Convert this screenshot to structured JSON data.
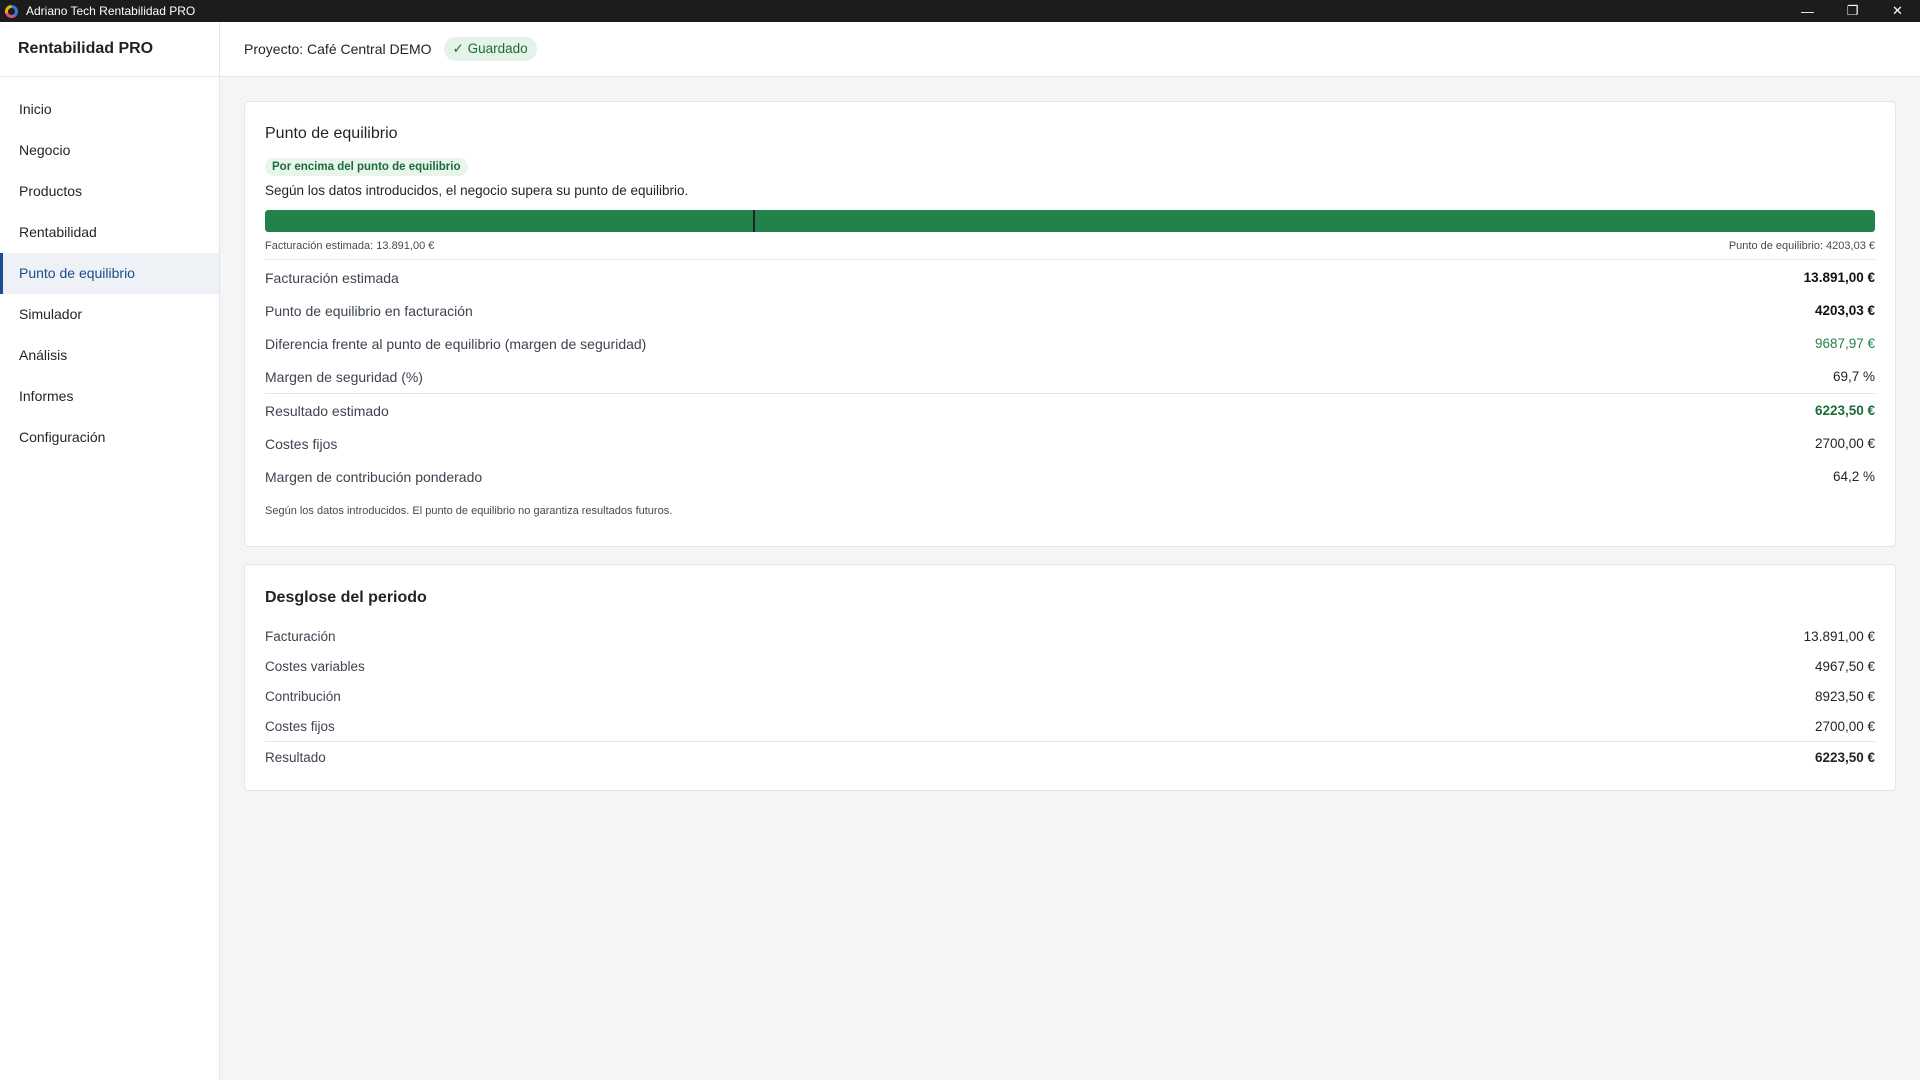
{
  "window": {
    "title": "Adriano Tech Rentabilidad PRO",
    "controls": {
      "minimize": "—",
      "maximize": "❐",
      "close": "✕"
    }
  },
  "sidebar": {
    "brand": "Rentabilidad PRO",
    "items": [
      {
        "label": "Inicio",
        "active": false
      },
      {
        "label": "Negocio",
        "active": false
      },
      {
        "label": "Productos",
        "active": false
      },
      {
        "label": "Rentabilidad",
        "active": false
      },
      {
        "label": "Punto de equilibrio",
        "active": true
      },
      {
        "label": "Simulador",
        "active": false
      },
      {
        "label": "Análisis",
        "active": false
      },
      {
        "label": "Informes",
        "active": false
      },
      {
        "label": "Configuración",
        "active": false
      }
    ]
  },
  "header": {
    "project": "Proyecto: Café Central DEMO",
    "saved": "✓ Guardado"
  },
  "breakeven": {
    "title": "Punto de equilibrio",
    "status": "Por encima del punto de equilibrio",
    "intro": "Según los datos introducidos, el negocio supera su punto de equilibrio.",
    "progress": {
      "fill_pct": 100,
      "breakeven_marker_pct": 30.3
    },
    "bar_left_label": "Facturación estimada: 13.891,00 €",
    "bar_right_label": "Punto de equilibrio: 4203,03 €",
    "metrics": [
      {
        "label": "Facturación estimada",
        "value": "13.891,00 €"
      },
      {
        "label": "Punto de equilibrio en facturación",
        "value": "4203,03 €"
      },
      {
        "label": "Diferencia frente al punto de equilibrio (margen de seguridad)",
        "value": "9687,97 €"
      },
      {
        "label": "Margen de seguridad (%)",
        "value": "69,7 %"
      },
      {
        "label": "Resultado estimado",
        "value": "6223,50 €"
      },
      {
        "label": "Costes fijos",
        "value": "2700,00 €"
      },
      {
        "label": "Margen de contribución ponderado",
        "value": "64,2 %"
      }
    ],
    "footnote": "Según los datos introducidos. El punto de equilibrio no garantiza resultados futuros."
  },
  "breakdown": {
    "title": "Desglose del periodo",
    "rows": [
      {
        "label": "Facturación",
        "value": "13.891,00 €"
      },
      {
        "label": "Costes variables",
        "value": "4967,50 €"
      },
      {
        "label": "Contribución",
        "value": "8923,50 €"
      },
      {
        "label": "Costes fijos",
        "value": "2700,00 €"
      },
      {
        "label": "Resultado",
        "value": "6223,50 €"
      }
    ]
  },
  "colors": {
    "accent": "#1a4d8f",
    "positive": "#23824a",
    "badge_bg": "#e3f3e8"
  }
}
